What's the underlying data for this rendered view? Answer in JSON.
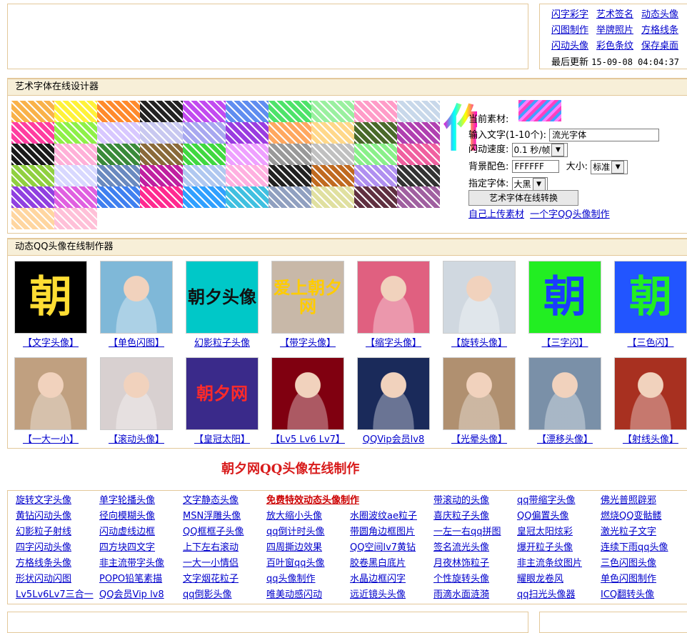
{
  "top_links": {
    "items": [
      "闪字彩字",
      "艺术签名",
      "动态头像",
      "闪图制作",
      "举牌照片",
      "方格线条",
      "闪动头像",
      "彩色条纹",
      "保存桌面"
    ],
    "update_label": "最后更新",
    "update_time": "15-09-08 04:04:37"
  },
  "designer": {
    "heading": "艺术字体在线设计器",
    "preview_char": "作",
    "current_material_label": "当前素材:",
    "input_label": "输入文字(1-10个):",
    "input_value": "流光字体",
    "speed_label": "闪动速度:",
    "speed_value": "0.1 秒/帧",
    "bg_label": "背景配色:",
    "bg_value": "FFFFFF",
    "size_label": "大小:",
    "size_value": "标准",
    "font_label": "指定字体:",
    "font_value": "大黑",
    "convert_button": "艺术字体在线转换",
    "upload_link": "自己上传素材",
    "single_char_link": "一个字QQ头像制作",
    "swatch_colors": [
      "#f9b24a",
      "#fff23a",
      "#ff8a2c",
      "#222222",
      "#c24af0",
      "#5f8df0",
      "#4ee36a",
      "#9af0a0",
      "#ff9cc8",
      "#c8d8ea",
      "#ff3da0",
      "#8ef048",
      "#d8c8ff",
      "#c8c8f0",
      "#a8a8f0",
      "#9a3ce0",
      "#ffa860",
      "#ffd88a",
      "#4a6a2a",
      "#b040b0",
      "#1a1a1a",
      "#ffb0d8",
      "#3a8a3a",
      "#8a6a3a",
      "#40d840",
      "#eea0ff",
      "#999999",
      "#c0c0c0",
      "#8af08a",
      "#f060a0",
      "#90d040",
      "#d8d8ff",
      "#6a8ac0",
      "#c020a0",
      "#b0c8f0",
      "#ffb0e0",
      "#222222",
      "#c06a20",
      "#b090f0",
      "#333333",
      "#9040e0",
      "#e060e0",
      "#4080f0",
      "#ff2a90",
      "#30a0ff",
      "#40c0e0",
      "#90a0c0",
      "#e0e0a0",
      "#603040",
      "#a060a0",
      "#ffd6a0",
      "#ffc0d8"
    ]
  },
  "avatars": {
    "heading": "动态QQ头像在线制作器",
    "items": [
      {
        "caption": "【文字头像】",
        "text": "朝",
        "bg": "#000000",
        "fg": "#ffdd33"
      },
      {
        "caption": "【单色闪图】",
        "text": "",
        "bg": "#7fb8d8",
        "fg": "#ffffff"
      },
      {
        "caption": "幻影粒子头像",
        "text": "朝夕头像",
        "bg": "#00c8c8",
        "fg": "#111111"
      },
      {
        "caption": "【带字头像】",
        "text": "爱上朝夕网",
        "bg": "#c8b8a8",
        "fg": "#ffcc00"
      },
      {
        "caption": "【缩字头像】",
        "text": "",
        "bg": "#e06080",
        "fg": "#ffffff"
      },
      {
        "caption": "【旋转头像】",
        "text": "",
        "bg": "#d0d8e0",
        "fg": "#ffffff"
      },
      {
        "caption": "【三字闪】",
        "text": "朝",
        "bg": "#22ee22",
        "fg": "#1a3cff"
      },
      {
        "caption": "【三色闪】",
        "text": "朝",
        "bg": "#2255ff",
        "fg": "#22ee22"
      },
      {
        "caption": "【一大一小】",
        "text": "",
        "bg": "#c0a080",
        "fg": "#ffffff"
      },
      {
        "caption": "【滚动头像】",
        "text": "",
        "bg": "#d8d0d0",
        "fg": "#ffffff"
      },
      {
        "caption": "【皇冠太阳】",
        "text": "朝夕网",
        "bg": "#3a2a8a",
        "fg": "#ff2a2a"
      },
      {
        "caption": "【Lv5 Lv6 Lv7】",
        "text": "",
        "bg": "#800010",
        "fg": "#ffffff"
      },
      {
        "caption": "QQVip会员lv8",
        "text": "",
        "bg": "#1a2a5a",
        "fg": "#ffffff"
      },
      {
        "caption": "【光晕头像】",
        "text": "",
        "bg": "#b09070",
        "fg": "#ffffff"
      },
      {
        "caption": "【漂移头像】",
        "text": "",
        "bg": "#7a90a8",
        "fg": "#ffffff"
      },
      {
        "caption": "【射线头像】",
        "text": "",
        "bg": "#a83020",
        "fg": "#ffffff"
      }
    ]
  },
  "big_title": "朝夕网QQ头像在线制作",
  "link_grid": [
    [
      "旋转文字头像",
      "单字轮播头像",
      "文字静态头像",
      "免费特效动态头像制作",
      "带滚动的头像",
      "qq带缩字头像",
      "佛光普照辟邪"
    ],
    [
      "黄钻闪动头像",
      "径向模糊头像",
      "MSN浮雕头像",
      "放大缩小头像",
      "水圈波纹ae粒子",
      "喜庆粒子头像",
      "QQ偏置头像",
      "燃烧QQ变骷髅"
    ],
    [
      "幻影粒子射线",
      "闪动虚线边框",
      "QQ框框子头像",
      "qq倒计时头像",
      "带圆角边框图片",
      "一左一右qq拼图",
      "皇冠太阳炫彩",
      "激光粒子文字"
    ],
    [
      "四字闪动头像",
      "四方块四文字",
      "上下左右滚动",
      "四周撕边效果",
      "QQ空间lv7黄钻",
      "签名流光头像",
      "爆开粒子头像",
      "连续下雨qq头像"
    ],
    [
      "方格线条头像",
      "非主流带字头像",
      "一大一小情侣",
      "百叶窗qq头像",
      "胶卷黑白底片",
      "月夜林饰粒子",
      "非主流条纹图片",
      "三色闪图头像"
    ],
    [
      "形状闪动闪图",
      "POPO铅笔素描",
      "文字烟花粒子",
      "qq头像制作",
      "水晶边框闪字",
      "个性旋转头像",
      "耀眼龙卷风",
      "单色闪图制作"
    ],
    [
      "Lv5Lv6Lv7三合一",
      "QQ会员Vip lv8",
      "qq倒影头像",
      "唯美动感闪动",
      "远近镜头头像",
      "雨滴水面涟漪",
      "qq扫光头像器",
      "ICQ翻转头像"
    ]
  ]
}
